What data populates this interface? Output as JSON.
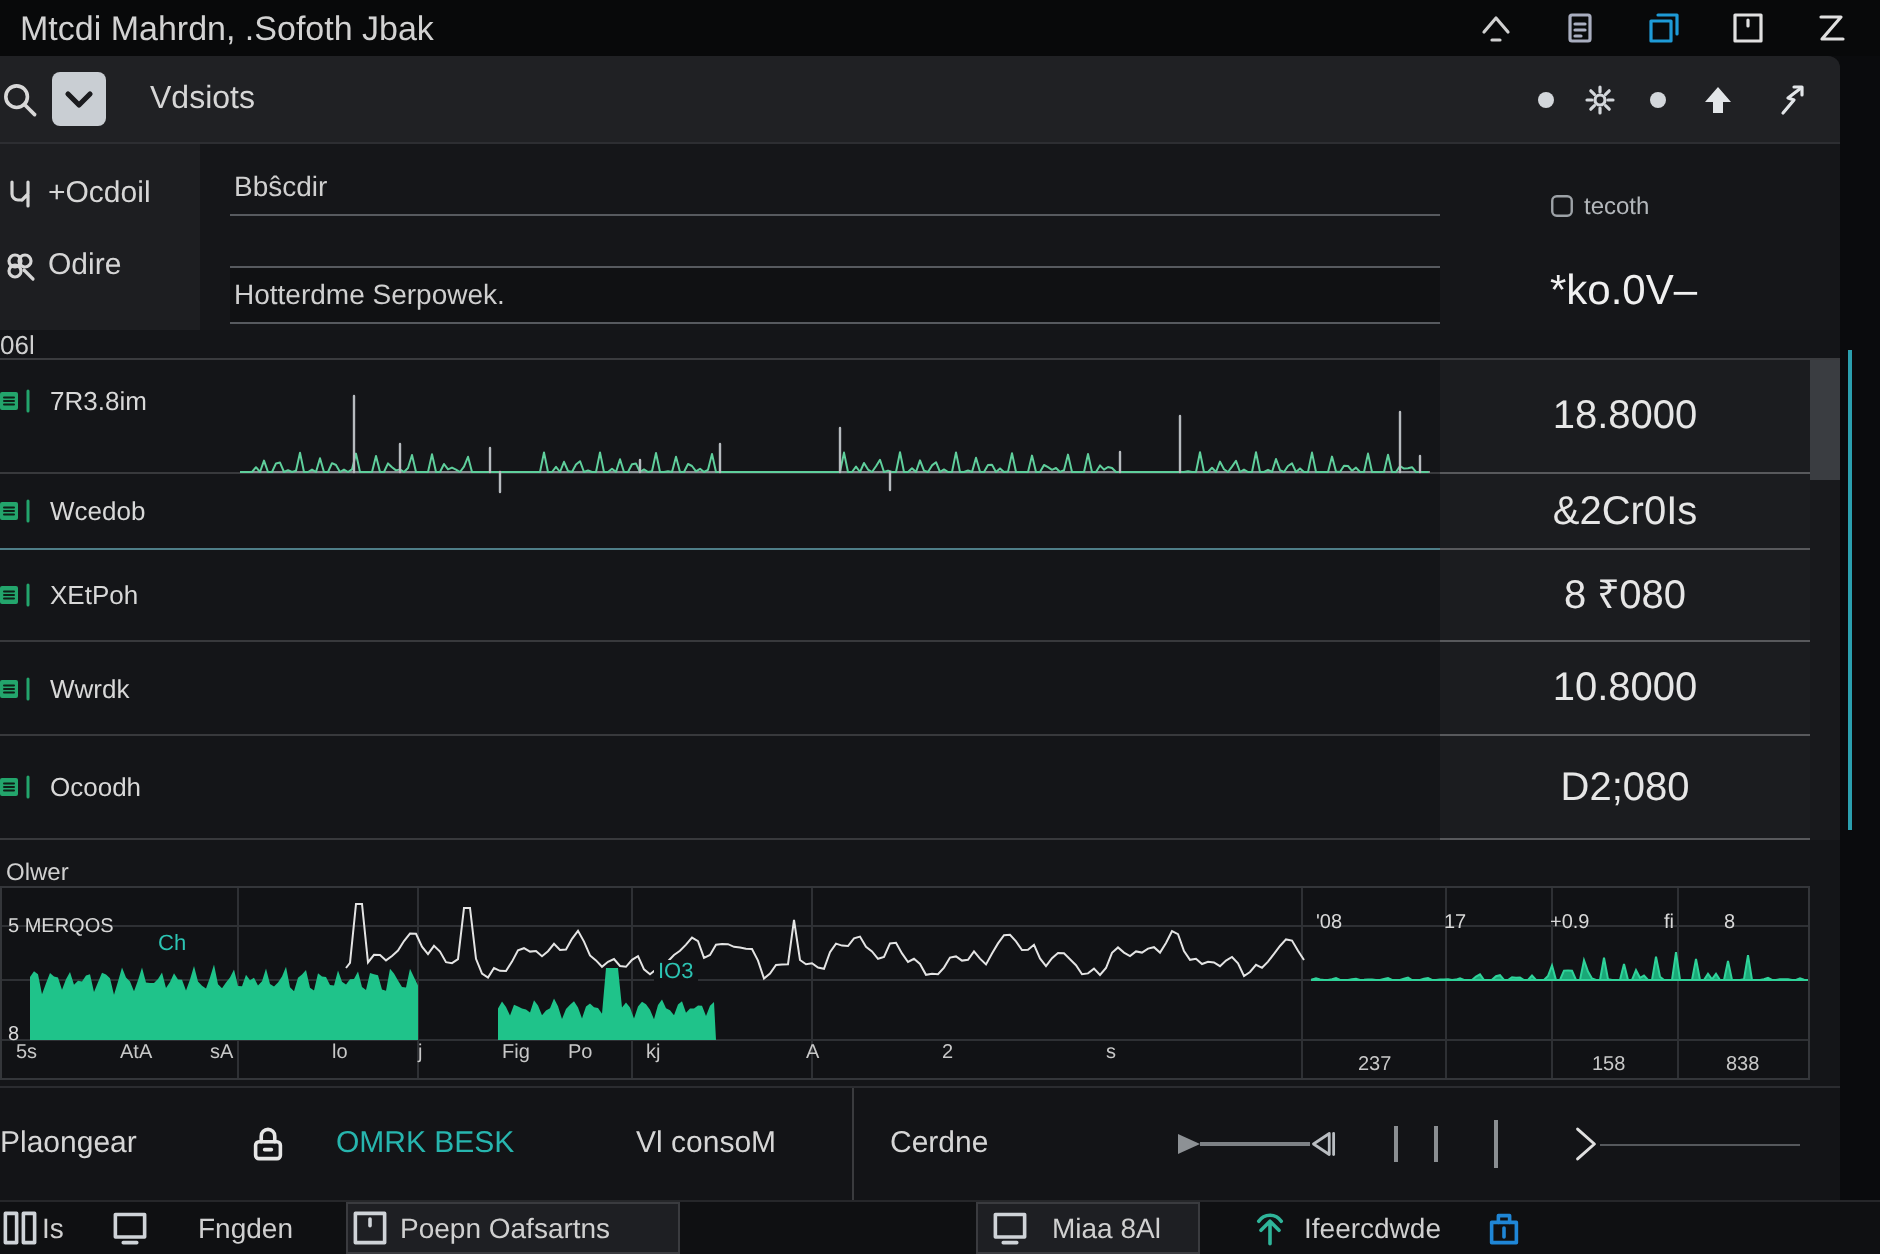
{
  "title_bar": {
    "title": "Mtcdi Mahrdn, .Sofoth Jbak"
  },
  "header": {
    "title": "Vdsiots"
  },
  "sidebar": {
    "items": [
      {
        "label": "+Ocdoil"
      },
      {
        "label": "Odire"
      }
    ]
  },
  "fields": [
    {
      "value": "Bbŝcdir"
    },
    {
      "value": "Hotterdme Serpowek."
    }
  ],
  "side_panel": {
    "label": "tecoth",
    "value": "*ko.0V–"
  },
  "section_label": "06l",
  "rows": [
    {
      "kind": "sparkline",
      "label": "7R3.8im",
      "value": "18.8000"
    },
    {
      "kind": "plain",
      "label": "Wcedob",
      "value": "&2Cr0Is"
    },
    {
      "kind": "plain",
      "label": "XEtPoh",
      "value": "8 ₹080"
    },
    {
      "kind": "plain",
      "label": "Wwrdk",
      "value": "10.8000"
    },
    {
      "kind": "plain",
      "label": "Ocoodh",
      "value": "D2;080"
    }
  ],
  "chart": {
    "title": "Olwer",
    "legend": "5 MERQOS",
    "y_labels": [
      "8"
    ],
    "series_labels": [
      "Ch",
      "IO3"
    ],
    "top_labels": [
      "'08",
      "17",
      "+0.9",
      "fi",
      "8"
    ],
    "x_labels": [
      "5s",
      "AtA",
      "sA",
      "lo",
      "j",
      "Fig",
      "Po",
      "kj",
      "A",
      "2",
      "s",
      "237",
      "158",
      "838"
    ]
  },
  "toolbar": {
    "tabs": [
      {
        "label": "Plaongear",
        "kind": "plain",
        "selected": false
      },
      {
        "label": "OMRK BESK",
        "kind": "lock",
        "selected": true
      },
      {
        "label": "Vl consoM",
        "kind": "plain",
        "selected": false
      },
      {
        "label": "Cerdne",
        "kind": "plain",
        "selected": false
      }
    ]
  },
  "taskbar": {
    "items": [
      {
        "label": "Is",
        "open": false
      },
      {
        "label": "Fngden",
        "open": false
      },
      {
        "label": "Poepn Oafsartns",
        "open": true
      },
      {
        "label": "Miaa 8Al",
        "open": true
      },
      {
        "label": "Ifeercdwde",
        "open": false
      }
    ]
  }
}
